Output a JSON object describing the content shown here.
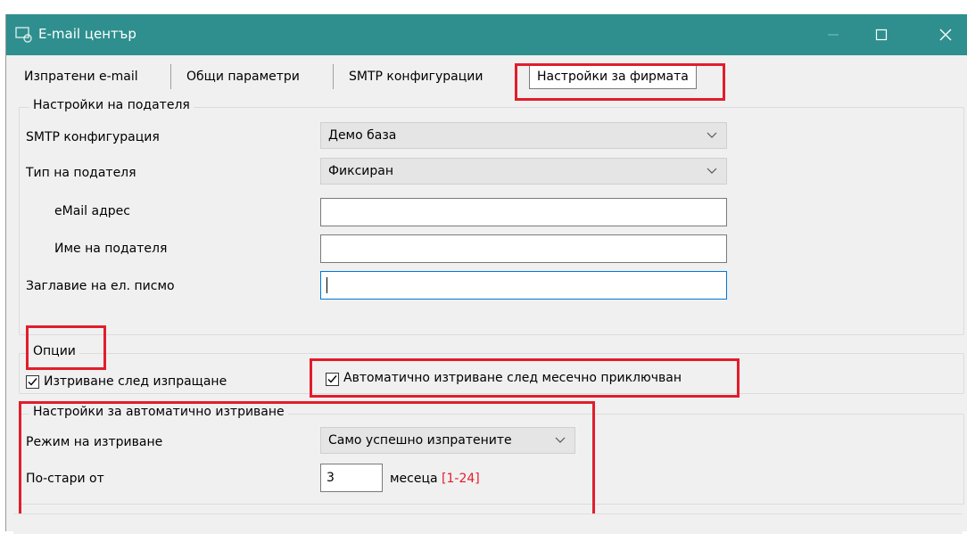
{
  "window": {
    "title": "E-mail център",
    "icon": "window-app-icon"
  },
  "tabs": [
    {
      "label": "Изпратени e-mail",
      "active": false
    },
    {
      "label": "Общи параметри",
      "active": false
    },
    {
      "label": "SMTP конфигурации",
      "active": false
    },
    {
      "label": "Настройки за фирмата",
      "active": true
    }
  ],
  "sender_settings": {
    "legend": "Настройки на подателя",
    "smtp_config_label": "SMTP конфигурация",
    "smtp_config_value": "Демо база",
    "sender_type_label": "Тип на подателя",
    "sender_type_value": "Фиксиран",
    "email_label": "eMail адрес",
    "email_value": "",
    "sender_name_label": "Име на подателя",
    "sender_name_value": "",
    "subject_label": "Заглавие на ел. писмо",
    "subject_value": ""
  },
  "options": {
    "legend": "Опции",
    "delete_after_send_label": "Изтриване след изпращане",
    "delete_after_send_checked": true,
    "auto_delete_monthly_label": "Автоматично изтриване след месечно приключван",
    "auto_delete_monthly_checked": true
  },
  "auto_delete": {
    "legend": "Настройки за автоматично изтриване",
    "mode_label": "Режим на изтриване",
    "mode_value": "Само успешно изпратените",
    "older_than_label": "По-стари от",
    "older_than_value": "3",
    "months_label": "месеца",
    "range_hint": "[1-24]"
  },
  "colors": {
    "titlebar": "#2e8f8e",
    "highlight": "#e21d2b",
    "focus": "#0078d7",
    "hint": "#e21d2b"
  }
}
